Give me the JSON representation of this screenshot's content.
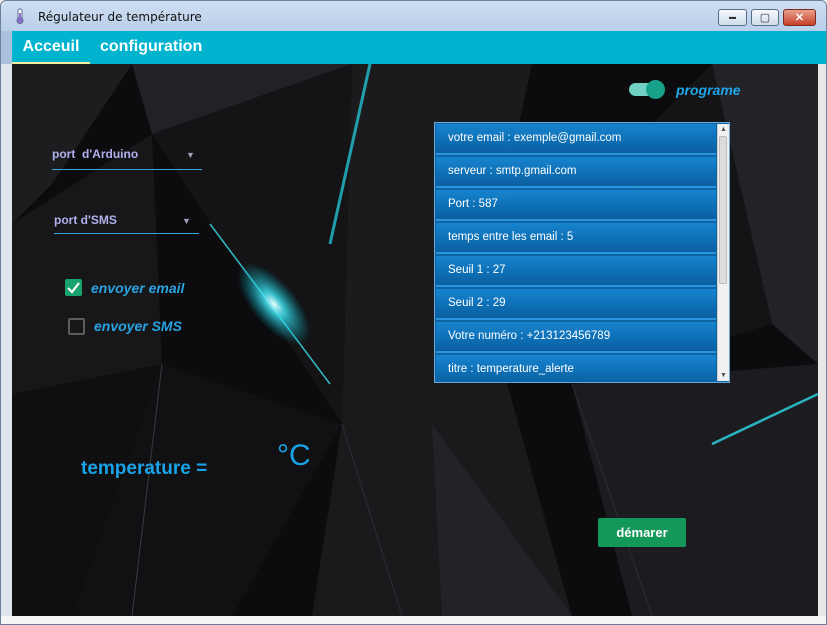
{
  "window": {
    "title": "Régulateur de température",
    "minimize_label": "▬",
    "maximize_label": "▢",
    "close_label": "✕"
  },
  "tabs": [
    {
      "label": "Acceuil"
    },
    {
      "label": "configuration"
    }
  ],
  "program": {
    "label": "programe",
    "on": true
  },
  "ports": {
    "arduino": "port  d'Arduino",
    "sms": "port d'SMS",
    "arrow": "▼"
  },
  "options": {
    "email_label": "envoyer email",
    "email_checked": true,
    "sms_label": "envoyer SMS",
    "sms_checked": false
  },
  "config_list": [
    "votre email : exemple@gmail.com",
    "serveur : smtp.gmail.com",
    "Port : 587",
    "temps  entre les email : 5",
    "Seuil 1 : 27",
    "Seuil 2 : 29",
    "Votre numéro : +213123456789",
    "titre : temperature_alerte"
  ],
  "scrollbar": {
    "up": "▲",
    "down": "▼"
  },
  "temperature": {
    "label": "temperature =",
    "value": "",
    "unit": "°C"
  },
  "start_button": "démarer",
  "colors": {
    "accent": "#00b4d0",
    "text_blue": "#1aa2e8",
    "button_green": "#14985a",
    "list_blue": "#0e70b6"
  }
}
